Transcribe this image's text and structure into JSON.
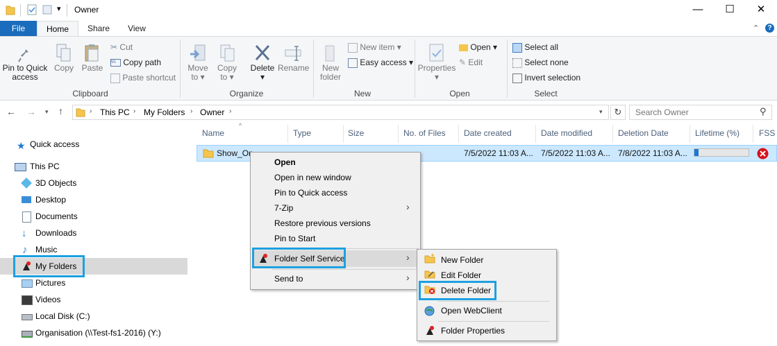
{
  "window": {
    "title": "Owner",
    "minimize": "—",
    "maximize": "☐",
    "close": "✕"
  },
  "tabs": {
    "file": "File",
    "home": "Home",
    "share": "Share",
    "view": "View"
  },
  "ribbon": {
    "clipboard": {
      "label": "Clipboard",
      "pin": [
        "Pin to Quick",
        "access"
      ],
      "copy": "Copy",
      "paste": "Paste",
      "cut": "Cut",
      "copy_path": "Copy path",
      "paste_shortcut": "Paste shortcut"
    },
    "organize": {
      "label": "Organize",
      "move_to": [
        "Move",
        "to ▾"
      ],
      "copy_to": [
        "Copy",
        "to ▾"
      ],
      "delete": [
        "Delete",
        "▾"
      ],
      "rename": "Rename"
    },
    "new": {
      "label": "New",
      "new_folder": [
        "New",
        "folder"
      ],
      "new_item": "New item ▾",
      "easy_access": "Easy access ▾"
    },
    "open": {
      "label": "Open",
      "properties": [
        "Properties",
        "▾"
      ],
      "open": "Open ▾",
      "edit": "Edit"
    },
    "select": {
      "label": "Select",
      "select_all": "Select all",
      "select_none": "Select none",
      "invert": "Invert selection"
    }
  },
  "address": {
    "crumbs": [
      "This PC",
      "My Folders",
      "Owner"
    ],
    "search_placeholder": "Search Owner"
  },
  "nav": {
    "items": [
      {
        "label": "Quick access"
      },
      {
        "label": "This PC"
      },
      {
        "label": "3D Objects"
      },
      {
        "label": "Desktop"
      },
      {
        "label": "Documents"
      },
      {
        "label": "Downloads"
      },
      {
        "label": "Music"
      },
      {
        "label": "My Folders"
      },
      {
        "label": "Pictures"
      },
      {
        "label": "Videos"
      },
      {
        "label": "Local Disk (C:)"
      },
      {
        "label": "Organisation (\\\\Test-fs1-2016) (Y:)"
      }
    ]
  },
  "columns": [
    "Name",
    "Type",
    "Size",
    "No. of Files",
    "Date created",
    "Date modified",
    "Deletion Date",
    "Lifetime (%)",
    "FSS S"
  ],
  "row": {
    "name": "Show_On",
    "date_created": "7/5/2022 11:03 A...",
    "date_modified": "7/5/2022 11:03 A...",
    "deletion_date": "7/8/2022 11:03 A...",
    "lifetime_pct": 8
  },
  "context_menu": {
    "items": [
      "Open",
      "Open in new window",
      "Pin to Quick access",
      "7-Zip",
      "Restore previous versions",
      "Pin to Start",
      "Folder Self Service",
      "Send to"
    ]
  },
  "submenu": {
    "items": [
      "New Folder",
      "Edit Folder",
      "Delete Folder",
      "Open WebClient",
      "Folder Properties"
    ]
  },
  "colors": {
    "accent": "#1a6cbc",
    "selection": "#cce8ff",
    "highlight": "#1da0e0"
  }
}
